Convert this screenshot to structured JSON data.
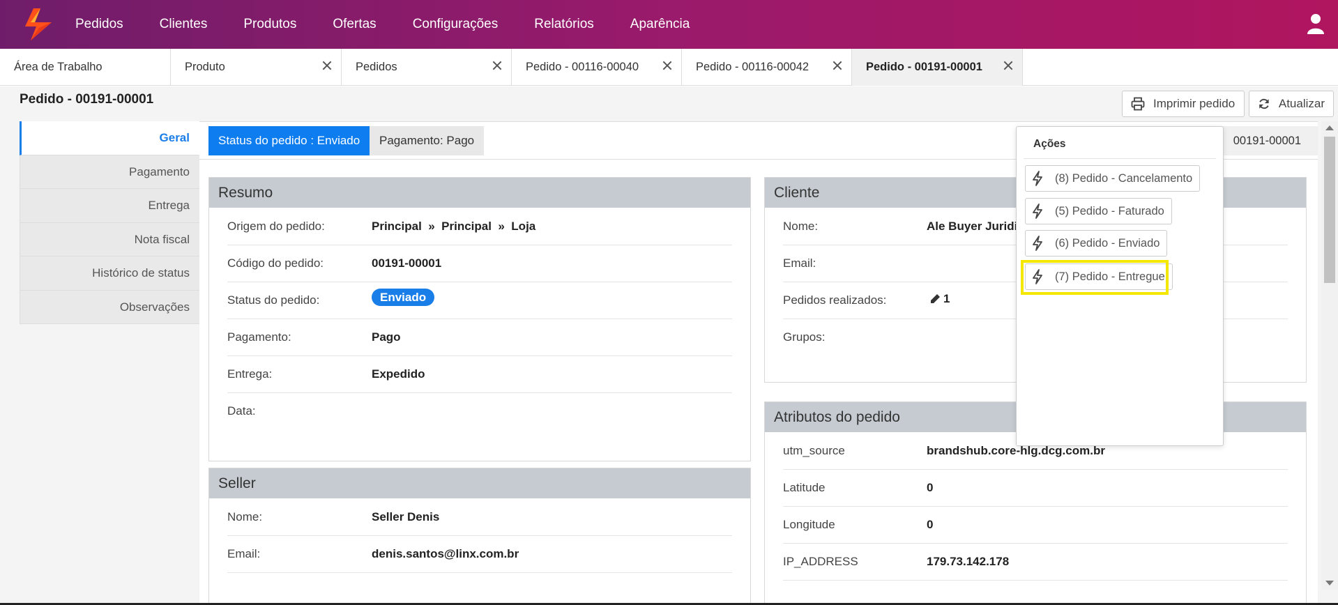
{
  "nav": {
    "items": [
      "Pedidos",
      "Clientes",
      "Produtos",
      "Ofertas",
      "Configurações",
      "Relatórios",
      "Aparência"
    ]
  },
  "tabs": [
    {
      "label": "Área de Trabalho"
    },
    {
      "label": "Produto"
    },
    {
      "label": "Pedidos"
    },
    {
      "label": "Pedido - 00116-00040"
    },
    {
      "label": "Pedido - 00116-00042"
    },
    {
      "label": "Pedido - 00191-00001"
    }
  ],
  "page": {
    "title": "Pedido - 00191-00001",
    "print_label": "Imprimir pedido",
    "refresh_label": "Atualizar"
  },
  "leftmenu": [
    "Geral",
    "Pagamento",
    "Entrega",
    "Nota fiscal",
    "Histórico de status",
    "Observações"
  ],
  "status_bar": {
    "status": "Status do pedido : Enviado",
    "payment": "Pagamento: Pago",
    "code": "00191-00001"
  },
  "resumo": {
    "title": "Resumo",
    "origem_label": "Origem do pedido:",
    "origem_value": "Principal  »  Principal  »  Loja",
    "codigo_label": "Código do pedido:",
    "codigo_value": "00191-00001",
    "status_label": "Status do pedido:",
    "status_value": "Enviado",
    "pagamento_label": "Pagamento:",
    "pagamento_value": "Pago",
    "entrega_label": "Entrega:",
    "entrega_value": "Expedido",
    "data_label": "Data:"
  },
  "seller": {
    "title": "Seller",
    "nome_label": "Nome:",
    "nome_value": "Seller Denis",
    "email_label": "Email:",
    "email_value": "denis.santos@linx.com.br"
  },
  "cliente": {
    "title": "Cliente",
    "nome_label": "Nome:",
    "nome_value": "Ale Buyer Juridic",
    "email_label": "Email:",
    "pedidos_label": "Pedidos realizados:",
    "pedidos_value": "1",
    "grupos_label": "Grupos:"
  },
  "atributos": {
    "title": "Atributos do pedido",
    "rows": [
      {
        "label": "utm_source",
        "value": "brandshub.core-hlg.dcg.com.br"
      },
      {
        "label": "Latitude",
        "value": "0"
      },
      {
        "label": "Longitude",
        "value": "0"
      },
      {
        "label": "IP_ADDRESS",
        "value": "179.73.142.178"
      }
    ]
  },
  "actions": {
    "title": "Ações",
    "items": [
      "(8) Pedido - Cancelamento",
      "(5) Pedido - Faturado",
      "(6) Pedido - Enviado",
      "(7) Pedido - Entregue"
    ]
  },
  "colors": {
    "brand_gradient_start": "#6f1d6a",
    "brand_gradient_end": "#b0155f",
    "accent_blue": "#0d7df0",
    "highlight": "#f5e800"
  }
}
